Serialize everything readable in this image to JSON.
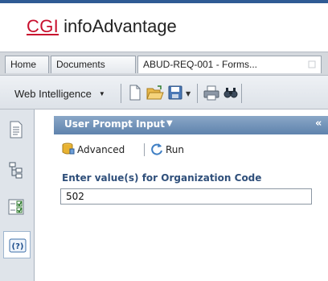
{
  "app": {
    "logo_brand": "CGI",
    "logo_product": " infoAdvantage"
  },
  "tabs": [
    {
      "label": "Home"
    },
    {
      "label": "Documents"
    },
    {
      "label": "ABUD-REQ-001 - Forms..."
    }
  ],
  "toolbar": {
    "mode_label": "Web Intelligence",
    "icons": [
      "new-document-icon",
      "open-folder-icon",
      "save-icon",
      "print-icon",
      "find-icon"
    ]
  },
  "left_panel": {
    "icons": [
      "document-summary-icon",
      "navigation-map-icon",
      "input-controls-icon",
      "user-prompt-icon"
    ],
    "selected": "user-prompt-icon"
  },
  "panel": {
    "title": "User Prompt Input",
    "collapse_glyph": "«",
    "advanced_label": "Advanced",
    "run_label": "Run",
    "prompt_label": "Enter value(s) for Organization Code",
    "prompt_value": "502"
  },
  "colors": {
    "brand_red": "#c8102e",
    "header_blue": "#5f83ad",
    "label_blue": "#2f4f7a"
  }
}
